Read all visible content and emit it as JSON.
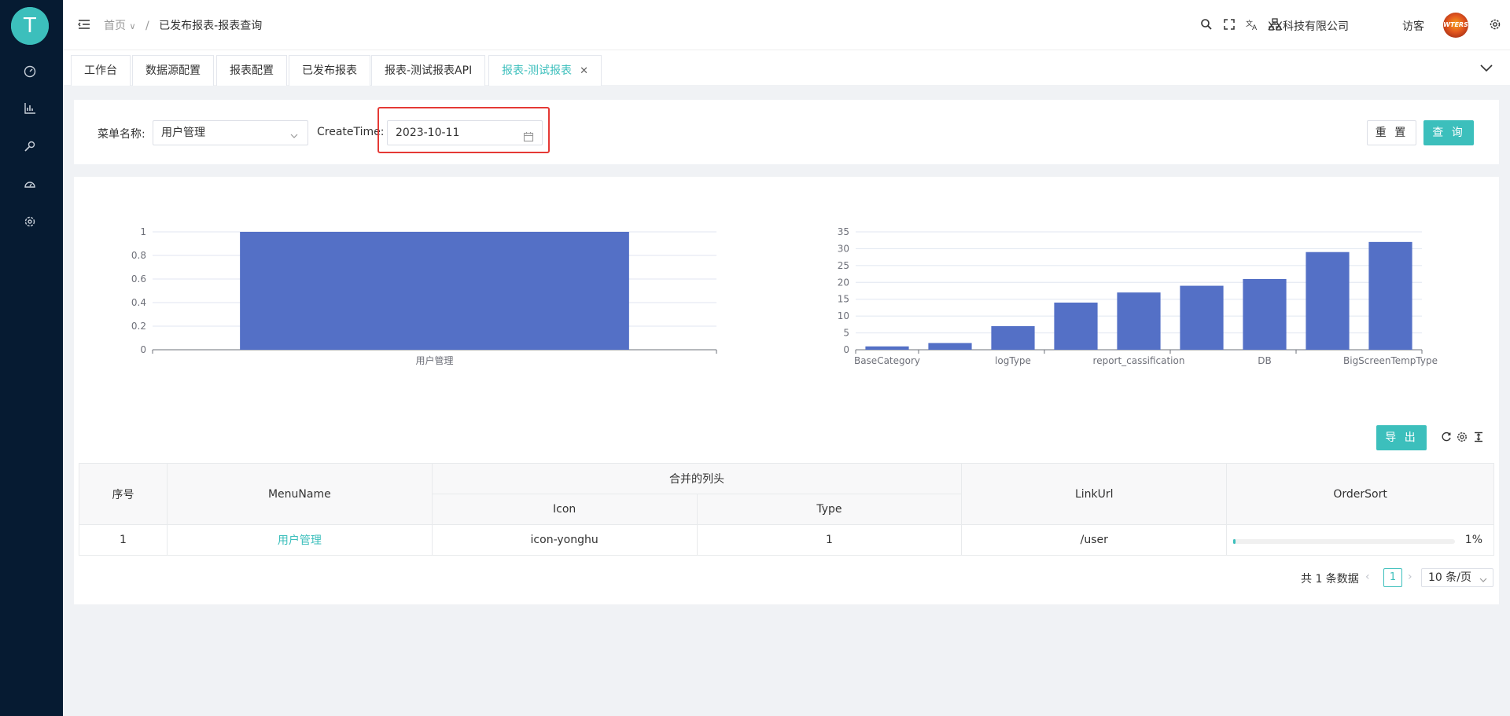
{
  "breadcrumb": {
    "home": "首页",
    "current": "已发布报表-报表查询"
  },
  "header": {
    "company": "XX科技有限公司",
    "visitor": "访客",
    "avatar_text": "WTERS"
  },
  "tabs": [
    {
      "label": "工作台"
    },
    {
      "label": "数据源配置"
    },
    {
      "label": "报表配置"
    },
    {
      "label": "已发布报表"
    },
    {
      "label": "报表-测试报表API"
    },
    {
      "label": "报表-测试报表",
      "active": true
    }
  ],
  "search": {
    "menu_label": "菜单名称:",
    "menu_value": "用户管理",
    "create_label": "CreateTime:",
    "date_value": "2023-10-11",
    "reset_label": "重 置",
    "query_label": "查 询"
  },
  "colors": {
    "accent": "#3cbfbc",
    "bar": "#5470c6",
    "highlight": "#e53935",
    "sidebar": "#061b32"
  },
  "chart_data": [
    {
      "type": "bar",
      "categories": [
        "用户管理"
      ],
      "values": [
        1
      ],
      "ylim": [
        0,
        1
      ],
      "yticks": [
        0,
        0.2,
        0.4,
        0.6,
        0.8,
        1
      ],
      "grid": true,
      "legend": "none"
    },
    {
      "type": "bar",
      "categories": [
        "BaseCategory",
        "",
        "logType",
        "",
        "report_cassification",
        "",
        "DB",
        "",
        "BigScreenTempType"
      ],
      "values": [
        1,
        2,
        7,
        14,
        17,
        19,
        21,
        29,
        32
      ],
      "ylim": [
        0,
        35
      ],
      "yticks": [
        0,
        5,
        10,
        15,
        20,
        25,
        30,
        35
      ],
      "grid": true,
      "legend": "none"
    }
  ],
  "toolbar": {
    "export_label": "导 出"
  },
  "table": {
    "headers": {
      "index": "序号",
      "menu_name": "MenuName",
      "merged": "合并的列头",
      "icon": "Icon",
      "type": "Type",
      "link_url": "LinkUrl",
      "order_sort": "OrderSort"
    },
    "rows": [
      {
        "index": "1",
        "menu_name": "用户管理",
        "icon": "icon-yonghu",
        "type": "1",
        "link_url": "/user",
        "order_sort_percent": 1,
        "order_sort_text": "1%"
      }
    ]
  },
  "pagination": {
    "total_text": "共 1 条数据",
    "current_page": "1",
    "page_size": "10 条/页"
  }
}
